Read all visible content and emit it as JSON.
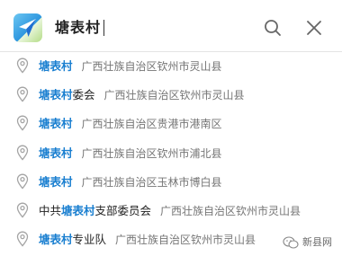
{
  "search": {
    "query": "塘表村"
  },
  "results": [
    {
      "prefix": "",
      "match": "塘表村",
      "suffix": "",
      "address": "广西壮族自治区钦州市灵山县"
    },
    {
      "prefix": "",
      "match": "塘表村",
      "suffix": "委会",
      "address": "广西壮族自治区钦州市灵山县"
    },
    {
      "prefix": "",
      "match": "塘表村",
      "suffix": "",
      "address": "广西壮族自治区贵港市港南区"
    },
    {
      "prefix": "",
      "match": "塘表村",
      "suffix": "",
      "address": "广西壮族自治区钦州市浦北县"
    },
    {
      "prefix": "",
      "match": "塘表村",
      "suffix": "",
      "address": "广西壮族自治区玉林市博白县"
    },
    {
      "prefix": "中共",
      "match": "塘表村",
      "suffix": "支部委员会",
      "address": "广西壮族自治区钦州市灵山县"
    },
    {
      "prefix": "",
      "match": "塘表村",
      "suffix": "专业队",
      "address": "广西壮族自治区钦州市灵山县"
    }
  ],
  "watermark": {
    "text": "新县网"
  },
  "colors": {
    "highlight": "#1a7fd0",
    "address": "#757575"
  },
  "icons": {
    "logo": "paper-plane-logo",
    "search": "search-icon",
    "close": "close-icon",
    "result": "location-pin-icon"
  }
}
